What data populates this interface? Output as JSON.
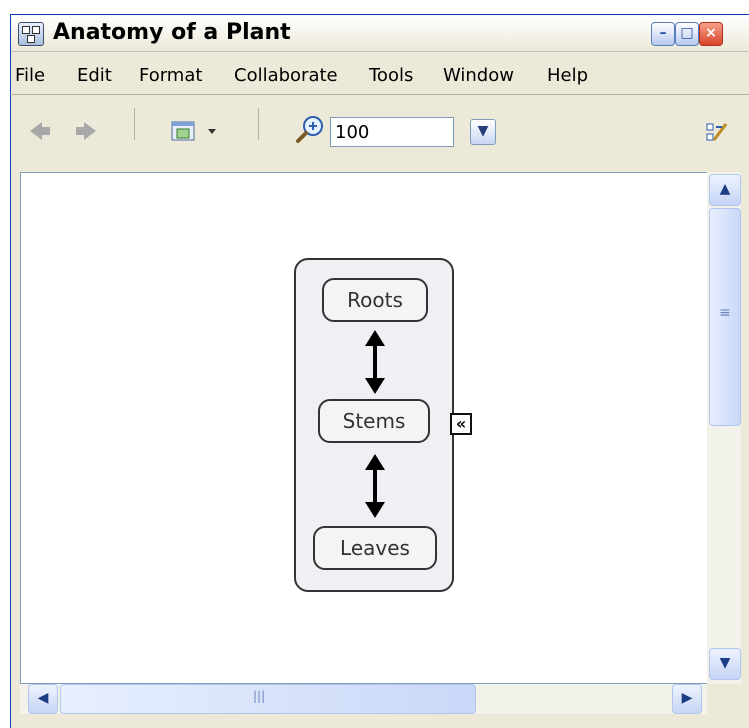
{
  "window": {
    "title": "Anatomy of a Plant",
    "controls": {
      "minimize": "–",
      "maximize": "□",
      "close": "×"
    }
  },
  "menubar": {
    "items": [
      "File",
      "Edit",
      "Format",
      "Collaborate",
      "Tools",
      "Window",
      "Help"
    ]
  },
  "toolbar": {
    "back_icon": "back-arrow-icon",
    "forward_icon": "forward-arrow-icon",
    "view_icon": "view-options-icon",
    "zoom_icon": "zoom-in-icon",
    "zoom_value": "100",
    "collaborate_icon": "collaborate-icon"
  },
  "concept_map": {
    "concepts": [
      {
        "label": "Roots"
      },
      {
        "label": "Stems"
      },
      {
        "label": "Leaves"
      }
    ],
    "links": [
      {
        "from": "Roots",
        "to": "Stems",
        "type": "bidirectional"
      },
      {
        "from": "Stems",
        "to": "Leaves",
        "type": "bidirectional"
      }
    ],
    "collapse_glyph": "«"
  },
  "scrollbars": {
    "up": "▲",
    "down": "▼",
    "left": "◀",
    "right": "▶",
    "grip": "≡",
    "hgrip": "|||"
  },
  "colors": {
    "window_bg": "#ece9d8",
    "canvas_bg": "#ffffff",
    "concept_border": "#333333"
  }
}
